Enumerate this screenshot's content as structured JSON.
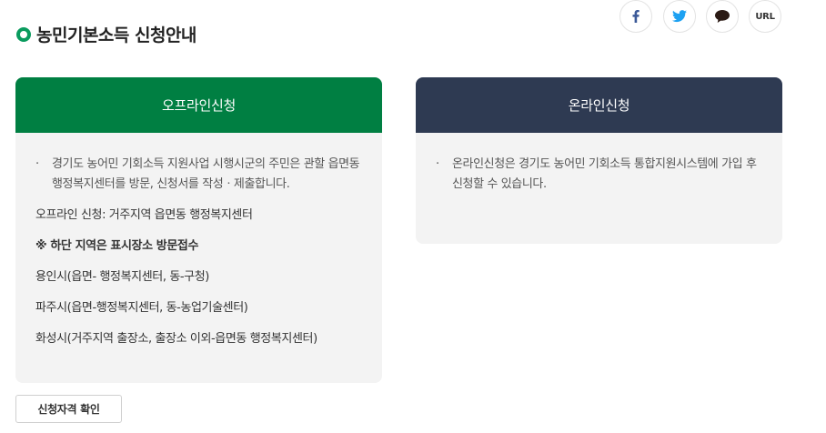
{
  "page_title": "농민기본소득 신청안내",
  "share": {
    "facebook_icon": "facebook-icon",
    "twitter_icon": "twitter-icon",
    "comment_icon": "speech-bubble-icon",
    "url_label": "URL"
  },
  "offline": {
    "header": "오프라인신청",
    "header_color": "#007f42",
    "bullet_text": "경기도 농어민 기회소득 지원사업 시행시군의 주민은 관할 읍면동 행정복지센터를 방문, 신청서를 작성ㆍ제출합니다.",
    "lines": [
      "오프라인 신청: 거주지역 읍면동 행정복지센터",
      "※ 하단 지역은 표시장소 방문접수",
      "용인시(읍면- 행정복지센터, 동-구청)",
      "파주시(읍면-행정복지센터, 동-농업기술센터)",
      "화성시(거주지역 출장소, 출장소 이외-읍면동 행정복지센터)"
    ]
  },
  "online": {
    "header": "온라인신청",
    "header_color": "#2e3a52",
    "bullet_text": "온라인신청은 경기도 농어민 기회소득 통합지원시스템에 가입 후 신청할 수 있습니다."
  },
  "eligibility_button": "신청자격 확인",
  "accent_color": "#0a9b5e"
}
